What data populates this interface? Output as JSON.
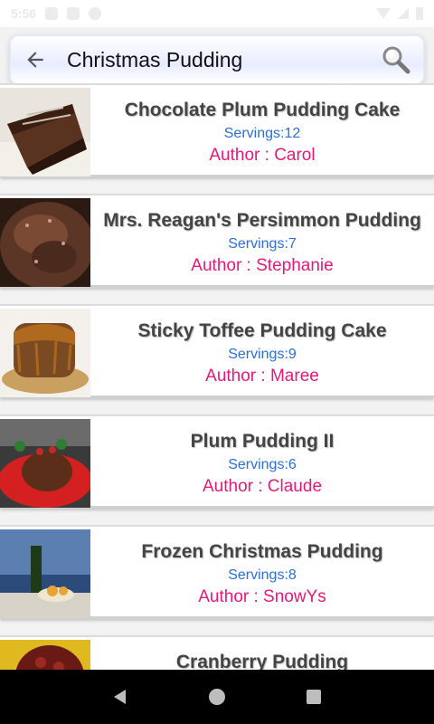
{
  "status_bar": {
    "time": "5:56"
  },
  "header": {
    "title": "Christmas Pudding",
    "back_icon": "arrow-left-icon",
    "search_icon": "magnifier-icon"
  },
  "recipes": [
    {
      "title": "Chocolate Plum Pudding Cake",
      "servings": "Servings:12",
      "author": "Author : Carol"
    },
    {
      "title": "Mrs. Reagan's Persimmon Pudding",
      "servings": "Servings:7",
      "author": "Author : Stephanie"
    },
    {
      "title": "Sticky Toffee Pudding Cake",
      "servings": "Servings:9",
      "author": "Author : Maree"
    },
    {
      "title": "Plum Pudding II",
      "servings": "Servings:6",
      "author": "Author : Claude"
    },
    {
      "title": "Frozen Christmas Pudding",
      "servings": "Servings:8",
      "author": "Author : SnowYs"
    },
    {
      "title": "Cranberry Pudding",
      "servings": "",
      "author": ""
    }
  ],
  "colors": {
    "servings": "#2b6fd6",
    "author": "#e8187a",
    "title": "#444444"
  }
}
